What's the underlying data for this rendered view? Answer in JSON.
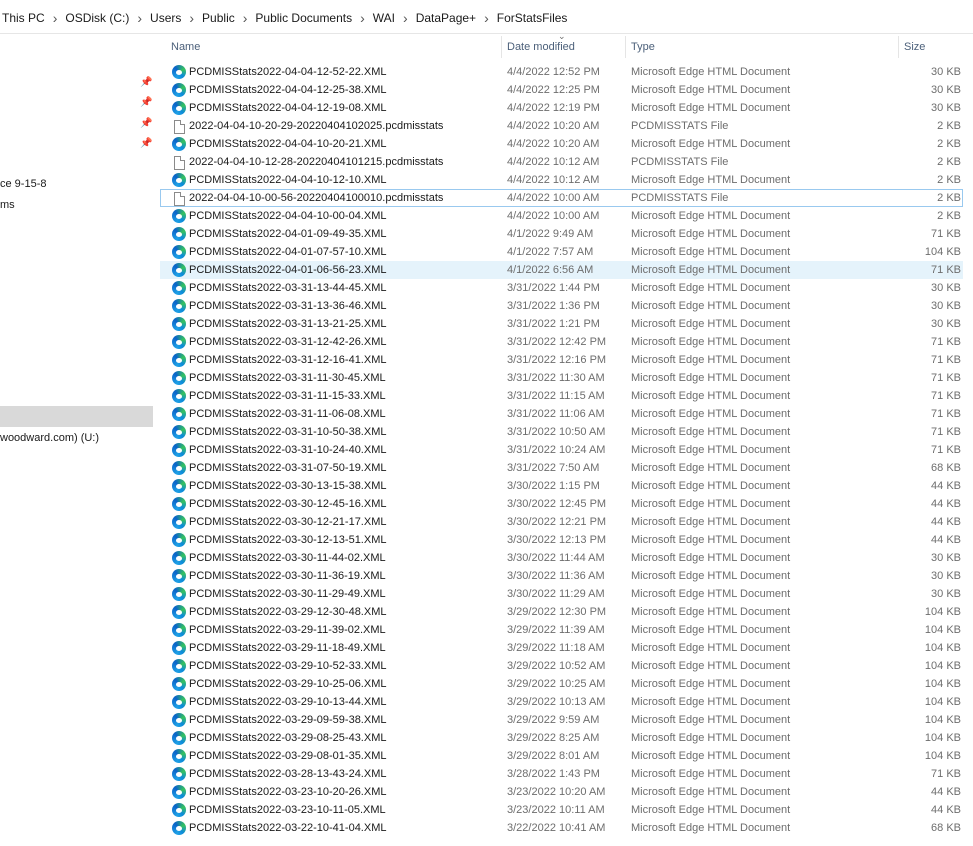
{
  "breadcrumb": [
    "This PC",
    "OSDisk (C:)",
    "Users",
    "Public",
    "Public Documents",
    "WAI",
    "DataPage+",
    "ForStatsFiles"
  ],
  "nav": {
    "item_a": "ce 9-15-8",
    "item_b": "ms",
    "item_c": "woodward.com) (U:)",
    "pins": [
      "pin-icon",
      "pin-icon",
      "pin-icon",
      "pin-icon"
    ]
  },
  "columns": {
    "name": "Name",
    "date": "Date modified",
    "type": "Type",
    "size": "Size"
  },
  "icons": {
    "xml": "edge-browser-icon",
    "stats": "generic-file-icon"
  },
  "files": [
    {
      "name": "PCDMISStats2022-04-04-12-52-22.XML",
      "date": "4/4/2022 12:52 PM",
      "type": "Microsoft Edge HTML Document",
      "size": "30 KB",
      "icon": "xml"
    },
    {
      "name": "PCDMISStats2022-04-04-12-25-38.XML",
      "date": "4/4/2022 12:25 PM",
      "type": "Microsoft Edge HTML Document",
      "size": "30 KB",
      "icon": "xml"
    },
    {
      "name": "PCDMISStats2022-04-04-12-19-08.XML",
      "date": "4/4/2022 12:19 PM",
      "type": "Microsoft Edge HTML Document",
      "size": "30 KB",
      "icon": "xml"
    },
    {
      "name": "2022-04-04-10-20-29-20220404102025.pcdmisstats",
      "date": "4/4/2022 10:20 AM",
      "type": "PCDMISSTATS File",
      "size": "2 KB",
      "icon": "stats"
    },
    {
      "name": "PCDMISStats2022-04-04-10-20-21.XML",
      "date": "4/4/2022 10:20 AM",
      "type": "Microsoft Edge HTML Document",
      "size": "2 KB",
      "icon": "xml"
    },
    {
      "name": "2022-04-04-10-12-28-20220404101215.pcdmisstats",
      "date": "4/4/2022 10:12 AM",
      "type": "PCDMISSTATS File",
      "size": "2 KB",
      "icon": "stats"
    },
    {
      "name": "PCDMISStats2022-04-04-10-12-10.XML",
      "date": "4/4/2022 10:12 AM",
      "type": "Microsoft Edge HTML Document",
      "size": "2 KB",
      "icon": "xml"
    },
    {
      "name": "2022-04-04-10-00-56-20220404100010.pcdmisstats",
      "date": "4/4/2022 10:00 AM",
      "type": "PCDMISSTATS File",
      "size": "2 KB",
      "icon": "stats",
      "state": "focused"
    },
    {
      "name": "PCDMISStats2022-04-04-10-00-04.XML",
      "date": "4/4/2022 10:00 AM",
      "type": "Microsoft Edge HTML Document",
      "size": "2 KB",
      "icon": "xml"
    },
    {
      "name": "PCDMISStats2022-04-01-09-49-35.XML",
      "date": "4/1/2022 9:49 AM",
      "type": "Microsoft Edge HTML Document",
      "size": "71 KB",
      "icon": "xml"
    },
    {
      "name": "PCDMISStats2022-04-01-07-57-10.XML",
      "date": "4/1/2022 7:57 AM",
      "type": "Microsoft Edge HTML Document",
      "size": "104 KB",
      "icon": "xml"
    },
    {
      "name": "PCDMISStats2022-04-01-06-56-23.XML",
      "date": "4/1/2022 6:56 AM",
      "type": "Microsoft Edge HTML Document",
      "size": "71 KB",
      "icon": "xml",
      "state": "selected"
    },
    {
      "name": "PCDMISStats2022-03-31-13-44-45.XML",
      "date": "3/31/2022 1:44 PM",
      "type": "Microsoft Edge HTML Document",
      "size": "30 KB",
      "icon": "xml"
    },
    {
      "name": "PCDMISStats2022-03-31-13-36-46.XML",
      "date": "3/31/2022 1:36 PM",
      "type": "Microsoft Edge HTML Document",
      "size": "30 KB",
      "icon": "xml"
    },
    {
      "name": "PCDMISStats2022-03-31-13-21-25.XML",
      "date": "3/31/2022 1:21 PM",
      "type": "Microsoft Edge HTML Document",
      "size": "30 KB",
      "icon": "xml"
    },
    {
      "name": "PCDMISStats2022-03-31-12-42-26.XML",
      "date": "3/31/2022 12:42 PM",
      "type": "Microsoft Edge HTML Document",
      "size": "71 KB",
      "icon": "xml"
    },
    {
      "name": "PCDMISStats2022-03-31-12-16-41.XML",
      "date": "3/31/2022 12:16 PM",
      "type": "Microsoft Edge HTML Document",
      "size": "71 KB",
      "icon": "xml"
    },
    {
      "name": "PCDMISStats2022-03-31-11-30-45.XML",
      "date": "3/31/2022 11:30 AM",
      "type": "Microsoft Edge HTML Document",
      "size": "71 KB",
      "icon": "xml"
    },
    {
      "name": "PCDMISStats2022-03-31-11-15-33.XML",
      "date": "3/31/2022 11:15 AM",
      "type": "Microsoft Edge HTML Document",
      "size": "71 KB",
      "icon": "xml"
    },
    {
      "name": "PCDMISStats2022-03-31-11-06-08.XML",
      "date": "3/31/2022 11:06 AM",
      "type": "Microsoft Edge HTML Document",
      "size": "71 KB",
      "icon": "xml"
    },
    {
      "name": "PCDMISStats2022-03-31-10-50-38.XML",
      "date": "3/31/2022 10:50 AM",
      "type": "Microsoft Edge HTML Document",
      "size": "71 KB",
      "icon": "xml"
    },
    {
      "name": "PCDMISStats2022-03-31-10-24-40.XML",
      "date": "3/31/2022 10:24 AM",
      "type": "Microsoft Edge HTML Document",
      "size": "71 KB",
      "icon": "xml"
    },
    {
      "name": "PCDMISStats2022-03-31-07-50-19.XML",
      "date": "3/31/2022 7:50 AM",
      "type": "Microsoft Edge HTML Document",
      "size": "68 KB",
      "icon": "xml"
    },
    {
      "name": "PCDMISStats2022-03-30-13-15-38.XML",
      "date": "3/30/2022 1:15 PM",
      "type": "Microsoft Edge HTML Document",
      "size": "44 KB",
      "icon": "xml"
    },
    {
      "name": "PCDMISStats2022-03-30-12-45-16.XML",
      "date": "3/30/2022 12:45 PM",
      "type": "Microsoft Edge HTML Document",
      "size": "44 KB",
      "icon": "xml"
    },
    {
      "name": "PCDMISStats2022-03-30-12-21-17.XML",
      "date": "3/30/2022 12:21 PM",
      "type": "Microsoft Edge HTML Document",
      "size": "44 KB",
      "icon": "xml"
    },
    {
      "name": "PCDMISStats2022-03-30-12-13-51.XML",
      "date": "3/30/2022 12:13 PM",
      "type": "Microsoft Edge HTML Document",
      "size": "44 KB",
      "icon": "xml"
    },
    {
      "name": "PCDMISStats2022-03-30-11-44-02.XML",
      "date": "3/30/2022 11:44 AM",
      "type": "Microsoft Edge HTML Document",
      "size": "30 KB",
      "icon": "xml"
    },
    {
      "name": "PCDMISStats2022-03-30-11-36-19.XML",
      "date": "3/30/2022 11:36 AM",
      "type": "Microsoft Edge HTML Document",
      "size": "30 KB",
      "icon": "xml"
    },
    {
      "name": "PCDMISStats2022-03-30-11-29-49.XML",
      "date": "3/30/2022 11:29 AM",
      "type": "Microsoft Edge HTML Document",
      "size": "30 KB",
      "icon": "xml"
    },
    {
      "name": "PCDMISStats2022-03-29-12-30-48.XML",
      "date": "3/29/2022 12:30 PM",
      "type": "Microsoft Edge HTML Document",
      "size": "104 KB",
      "icon": "xml"
    },
    {
      "name": "PCDMISStats2022-03-29-11-39-02.XML",
      "date": "3/29/2022 11:39 AM",
      "type": "Microsoft Edge HTML Document",
      "size": "104 KB",
      "icon": "xml"
    },
    {
      "name": "PCDMISStats2022-03-29-11-18-49.XML",
      "date": "3/29/2022 11:18 AM",
      "type": "Microsoft Edge HTML Document",
      "size": "104 KB",
      "icon": "xml"
    },
    {
      "name": "PCDMISStats2022-03-29-10-52-33.XML",
      "date": "3/29/2022 10:52 AM",
      "type": "Microsoft Edge HTML Document",
      "size": "104 KB",
      "icon": "xml"
    },
    {
      "name": "PCDMISStats2022-03-29-10-25-06.XML",
      "date": "3/29/2022 10:25 AM",
      "type": "Microsoft Edge HTML Document",
      "size": "104 KB",
      "icon": "xml"
    },
    {
      "name": "PCDMISStats2022-03-29-10-13-44.XML",
      "date": "3/29/2022 10:13 AM",
      "type": "Microsoft Edge HTML Document",
      "size": "104 KB",
      "icon": "xml"
    },
    {
      "name": "PCDMISStats2022-03-29-09-59-38.XML",
      "date": "3/29/2022 9:59 AM",
      "type": "Microsoft Edge HTML Document",
      "size": "104 KB",
      "icon": "xml"
    },
    {
      "name": "PCDMISStats2022-03-29-08-25-43.XML",
      "date": "3/29/2022 8:25 AM",
      "type": "Microsoft Edge HTML Document",
      "size": "104 KB",
      "icon": "xml"
    },
    {
      "name": "PCDMISStats2022-03-29-08-01-35.XML",
      "date": "3/29/2022 8:01 AM",
      "type": "Microsoft Edge HTML Document",
      "size": "104 KB",
      "icon": "xml"
    },
    {
      "name": "PCDMISStats2022-03-28-13-43-24.XML",
      "date": "3/28/2022 1:43 PM",
      "type": "Microsoft Edge HTML Document",
      "size": "71 KB",
      "icon": "xml"
    },
    {
      "name": "PCDMISStats2022-03-23-10-20-26.XML",
      "date": "3/23/2022 10:20 AM",
      "type": "Microsoft Edge HTML Document",
      "size": "44 KB",
      "icon": "xml"
    },
    {
      "name": "PCDMISStats2022-03-23-10-11-05.XML",
      "date": "3/23/2022 10:11 AM",
      "type": "Microsoft Edge HTML Document",
      "size": "44 KB",
      "icon": "xml"
    },
    {
      "name": "PCDMISStats2022-03-22-10-41-04.XML",
      "date": "3/22/2022 10:41 AM",
      "type": "Microsoft Edge HTML Document",
      "size": "68 KB",
      "icon": "xml"
    }
  ]
}
